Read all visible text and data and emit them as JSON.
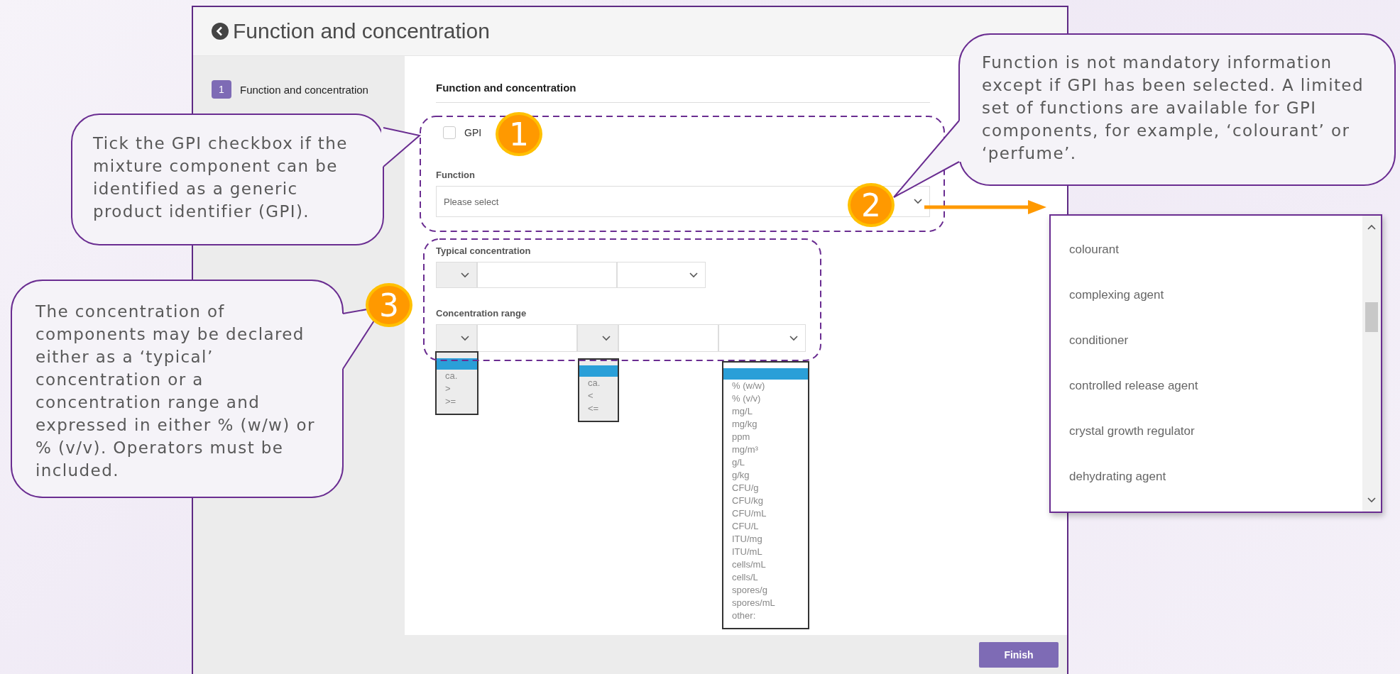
{
  "window": {
    "title": "Function and concentration"
  },
  "sidebar": {
    "steps": [
      {
        "number": "1",
        "label": "Function and concentration",
        "selected": true
      }
    ]
  },
  "form": {
    "heading": "Function and concentration",
    "gpi": {
      "label": "GPI",
      "checked": false
    },
    "function": {
      "label": "Function",
      "placeholder": "Please select"
    },
    "typical_concentration": {
      "label": "Typical concentration"
    },
    "concentration_range": {
      "label": "Concentration range"
    }
  },
  "open_lists": [
    {
      "options": [
        "ca.",
        ">",
        ">="
      ]
    },
    {
      "options": [
        "ca.",
        "<",
        "<="
      ]
    },
    {
      "options": [
        "% (w/w)",
        "% (v/v)",
        "mg/L",
        "mg/kg",
        "ppm",
        "mg/m³",
        "g/L",
        "g/kg",
        "CFU/g",
        "CFU/kg",
        "CFU/mL",
        "CFU/L",
        "ITU/mg",
        "ITU/mL",
        "cells/mL",
        "cells/L",
        "spores/g",
        "spores/mL",
        "other:"
      ]
    }
  ],
  "function_options": [
    "colourant",
    "complexing agent",
    "conditioner",
    "controlled release agent",
    "crystal growth regulator",
    "dehydrating agent"
  ],
  "callouts": [
    {
      "number": "1",
      "text": "Tick the GPI checkbox if the mixture component can be identified as a generic product identifier (GPI)."
    },
    {
      "number": "3",
      "text": "The concentration of components may be declared either as a ‘typical’ concentration or a concentration range and expressed in either % (w/w) or % (v/v). Operators must be included."
    },
    {
      "number": "2",
      "text": "Function is not mandatory information except if GPI has been selected. A limited set of functions are available for GPI components, for example, ‘colourant’ or ‘perfume’."
    }
  ],
  "footer": {
    "button": "Finish"
  }
}
